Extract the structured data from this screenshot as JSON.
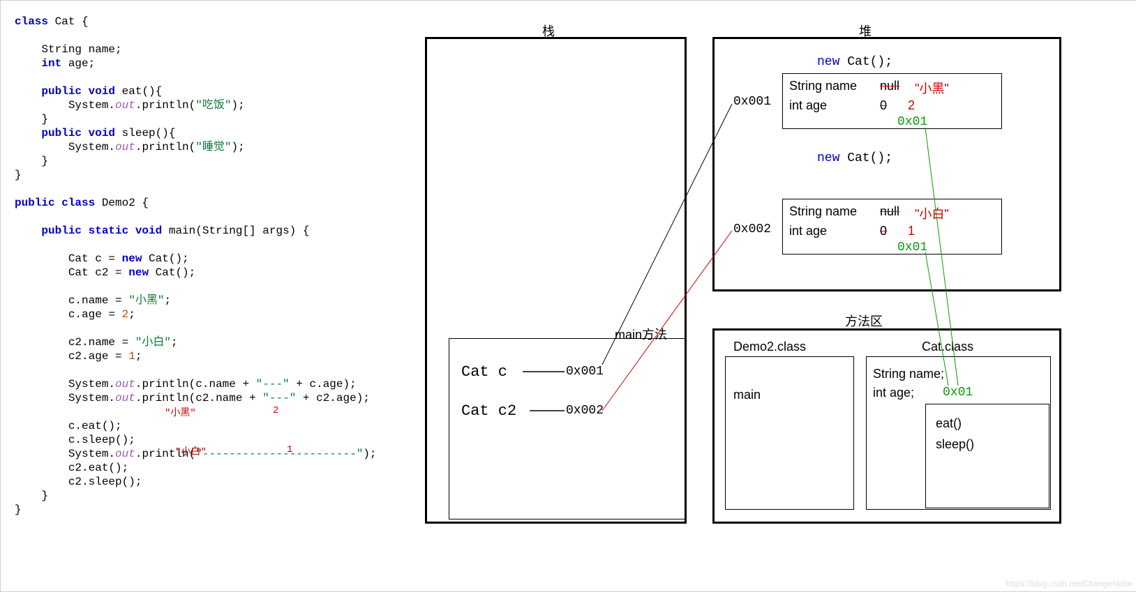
{
  "code": {
    "class1_open": "class Cat {",
    "fields": {
      "name": "    String name;",
      "age": "    int age;"
    },
    "method_eat_sig": "    public void eat(){",
    "method_eat_body": "        System.out.println(\"吃饭\");",
    "close_brace": "    }",
    "method_sleep_sig": "    public void sleep(){",
    "method_sleep_body": "        System.out.println(\"睡觉\");",
    "class1_close": "}",
    "class2_open": "public class Demo2 {",
    "main_sig": "    public static void main(String[] args) {",
    "c_decl": "        Cat c = new Cat();",
    "c2_decl": "        Cat c2 = new Cat();",
    "c_name": "        c.name = \"小黑\";",
    "c_age": "        c.age = 2;",
    "c2_name": "        c2.name = \"小白\";",
    "c2_age": "        c2.age = 1;",
    "print1": "        System.out.println(c.name + \"---\" + c.age);",
    "print2": "        System.out.println(c2.name + \"---\" + c2.age);",
    "eat1": "        c.eat();",
    "sleep1": "        c.sleep();",
    "print3": "        System.out.println(\"-----------------------\");",
    "eat2": "        c2.eat();",
    "sleep2": "        c2.sleep();",
    "main_close": "    }",
    "class2_close": "}",
    "anno1": "\"小黑\"",
    "anno2": "2",
    "anno3": "\"小白\"",
    "anno4": "1"
  },
  "labels": {
    "stack": "栈",
    "heap": "堆",
    "method_area": "方法区",
    "main_method": "main方法"
  },
  "stack": {
    "var1": "Cat c",
    "addr1": "0x001",
    "var2": "Cat c2",
    "addr2": "0x002"
  },
  "heap": {
    "heap_addr1": "0x001",
    "heap_addr2": "0x002",
    "new_cat": "new Cat();",
    "obj_name_label": "String name",
    "obj_age_label": "int age",
    "obj1_name_old": "null",
    "obj1_name_new": "\"小黑\"",
    "obj1_age_old": "0",
    "obj1_age_new": "2",
    "obj1_ref": "0x01",
    "obj2_name_old": "null",
    "obj2_name_new": "\"小白\"",
    "obj2_age_old": "0",
    "obj2_age_new": "1",
    "obj2_ref": "0x01"
  },
  "method_area": {
    "demo2_class": "Demo2.class",
    "demo2_main": "main",
    "cat_class": "Cat.class",
    "cat_field1": "String name;",
    "cat_field2": "int age;",
    "cat_addr": "0x01",
    "cat_method1": "eat()",
    "cat_method2": "sleep()"
  },
  "watermark": "https://blog.csdn.net/ChangeNone"
}
